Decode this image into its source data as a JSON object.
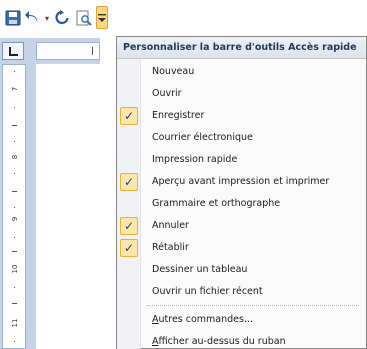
{
  "toolbar": {
    "buttons": [
      {
        "id": "save",
        "icon": "save-icon"
      },
      {
        "id": "undo",
        "icon": "undo-icon"
      },
      {
        "id": "undo-dropdown",
        "icon": "chevron-down-icon"
      },
      {
        "id": "redo",
        "icon": "redo-icon"
      },
      {
        "id": "print-preview",
        "icon": "print-preview-icon"
      },
      {
        "id": "customize",
        "icon": "customize-toolbar-icon"
      }
    ]
  },
  "ruler": {
    "numbers": [
      "7",
      "8",
      "9",
      "10",
      "11"
    ]
  },
  "menu": {
    "title": "Personnaliser la barre d'outils Accès rapide",
    "items": [
      {
        "label": "Nouveau",
        "checked": false
      },
      {
        "label": "Ouvrir",
        "checked": false
      },
      {
        "label": "Enregistrer",
        "checked": true
      },
      {
        "label": "Courrier électronique",
        "checked": false
      },
      {
        "label": "Impression rapide",
        "checked": false
      },
      {
        "label": "Aperçu avant impression et imprimer",
        "checked": true
      },
      {
        "label": "Grammaire et orthographe",
        "checked": false
      },
      {
        "label": "Annuler",
        "checked": true
      },
      {
        "label": "Rétablir",
        "checked": true
      },
      {
        "label": "Dessiner un tableau",
        "checked": false
      },
      {
        "label": "Ouvrir un fichier récent",
        "checked": false
      }
    ],
    "more_commands": "Autres commandes...",
    "show_below_ribbon": "Afficher au-dessus du ruban"
  },
  "colors": {
    "check_bg": "#fde7a8",
    "check_border": "#e2b23d",
    "check_mark": "#1f3f7a",
    "header_text": "#1e395b"
  }
}
